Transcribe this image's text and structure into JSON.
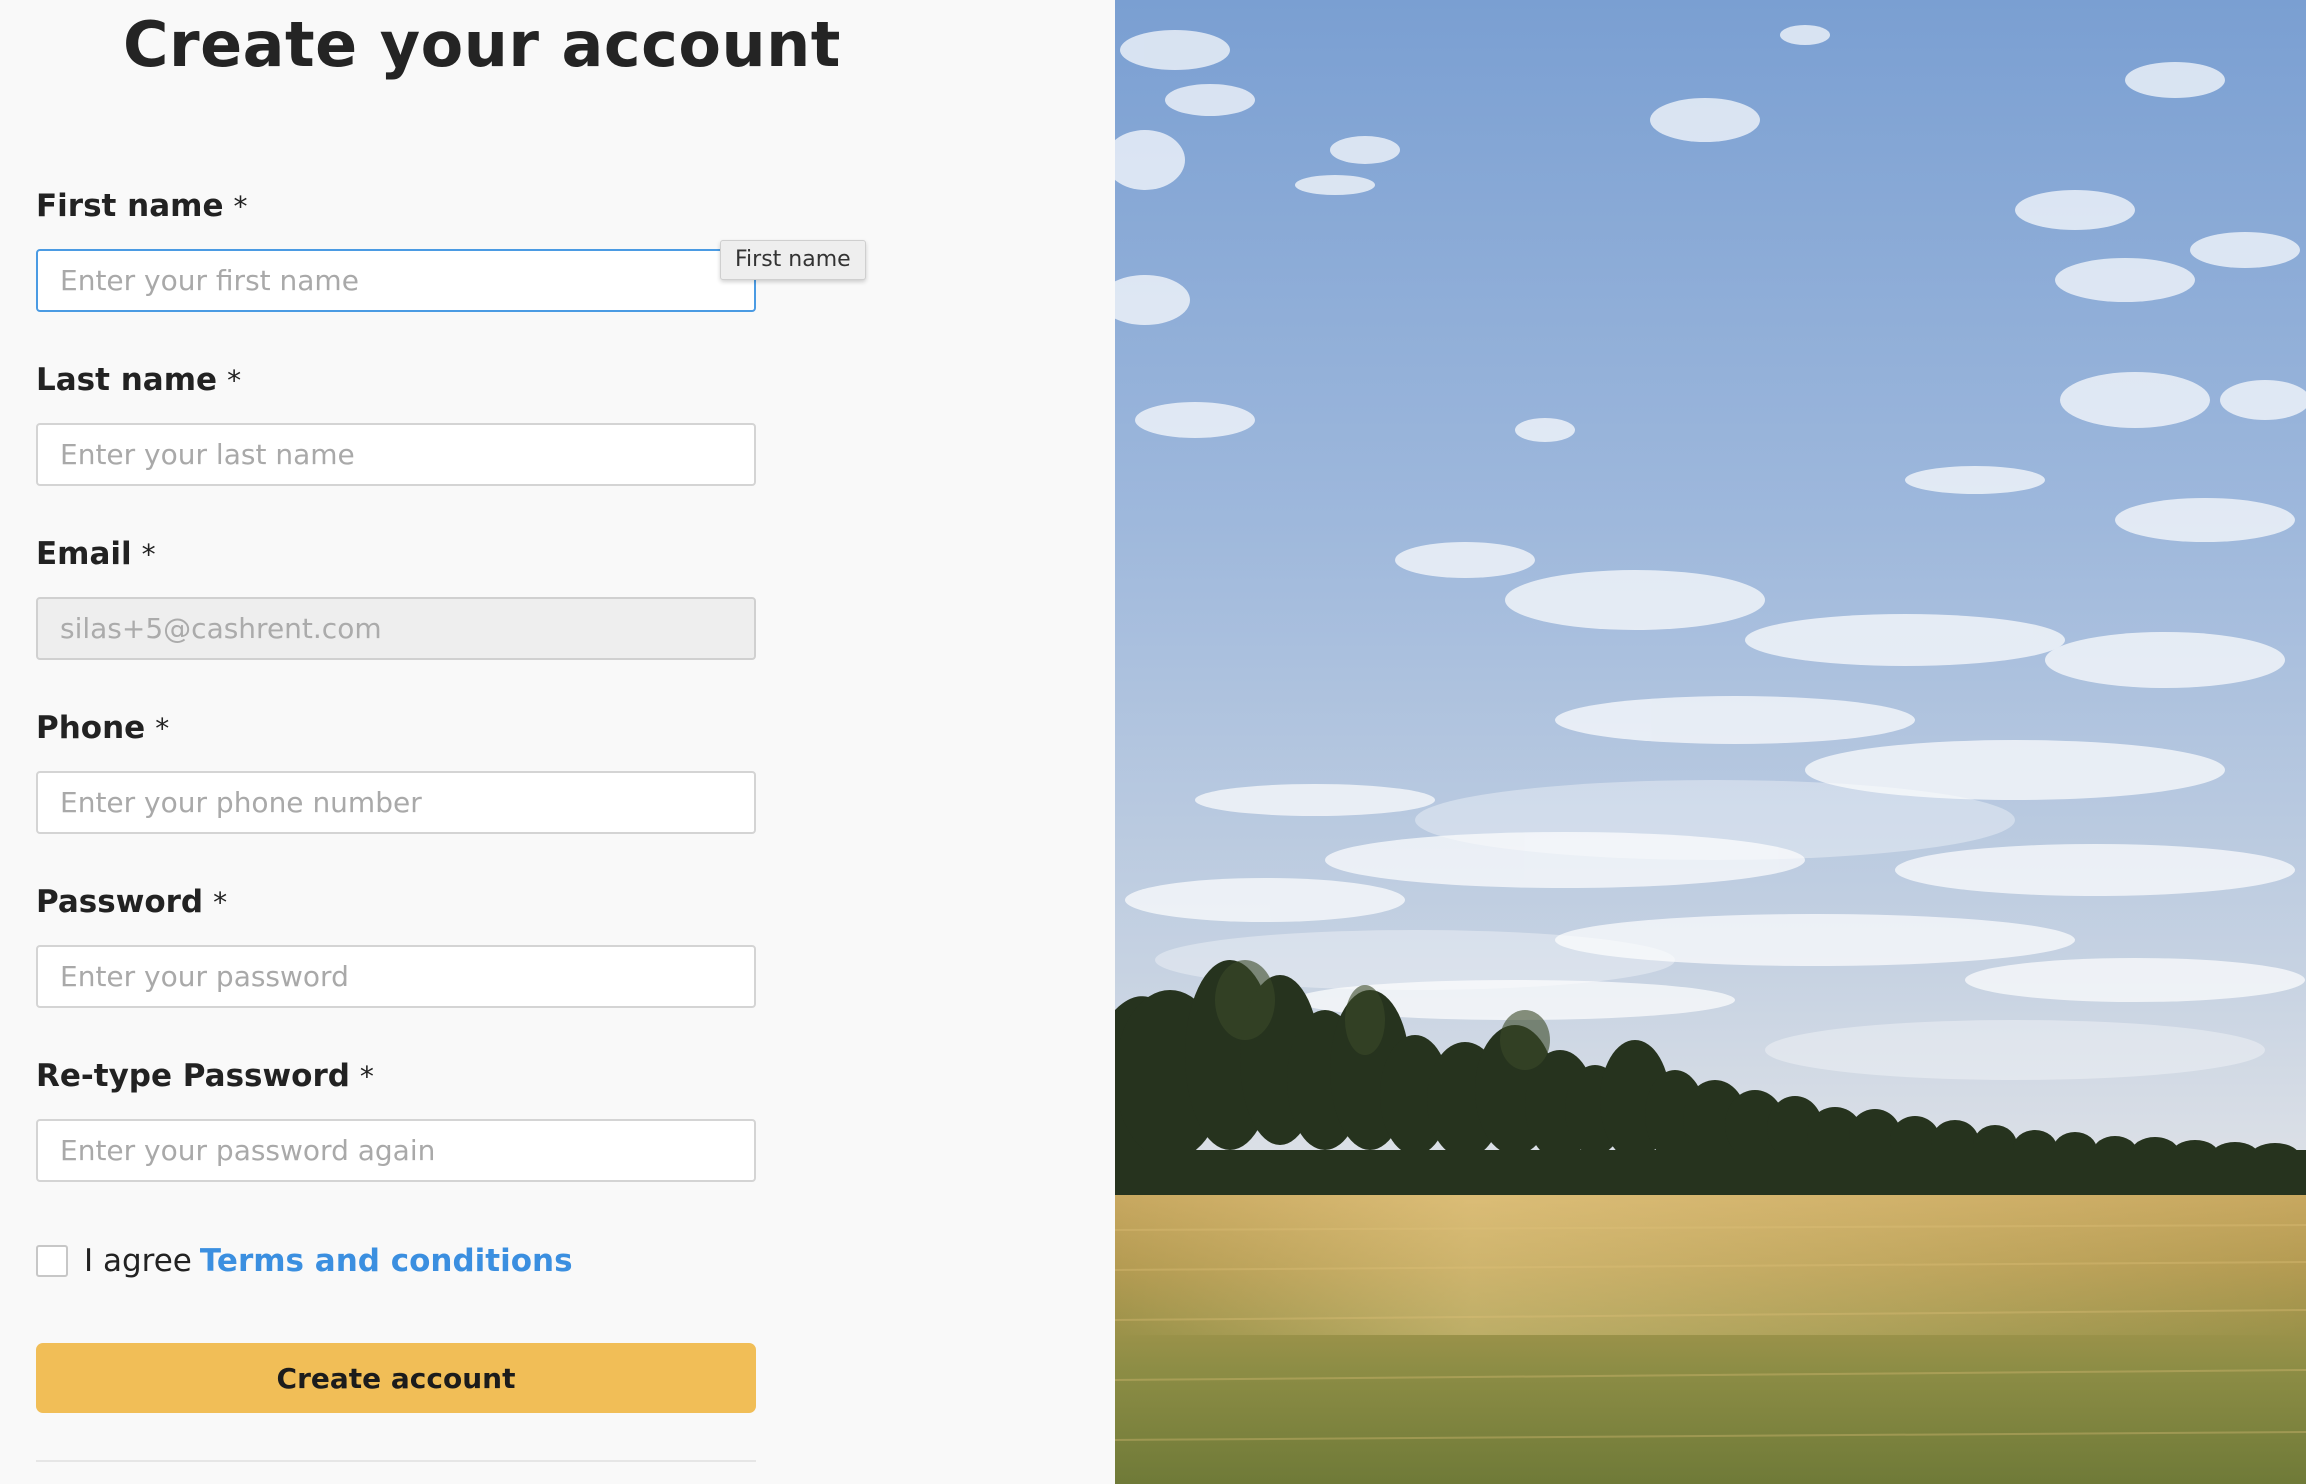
{
  "form": {
    "title": "Create your account",
    "required_mark": "*",
    "fields": {
      "first_name": {
        "label": "First name",
        "placeholder": "Enter your first name",
        "value": ""
      },
      "last_name": {
        "label": "Last name",
        "placeholder": "Enter your last name",
        "value": ""
      },
      "email": {
        "label": "Email",
        "placeholder": "",
        "value": "silas+5@cashrent.com"
      },
      "phone": {
        "label": "Phone",
        "placeholder": "Enter your phone number",
        "value": ""
      },
      "password": {
        "label": "Password",
        "placeholder": "Enter your password",
        "value": ""
      },
      "retype_password": {
        "label": "Re-type Password",
        "placeholder": "Enter your password again",
        "value": ""
      }
    },
    "tooltip": "First name",
    "agree_prefix": "I agree",
    "terms_link": "Terms and conditions",
    "submit_label": "Create account"
  },
  "colors": {
    "background": "#f9f9f9",
    "focus_border": "#4b9be3",
    "link": "#3b8fe0",
    "button": "#f1be57",
    "sky_top": "#7a9fd2",
    "sky_bottom": "#e2e4e8",
    "field": "#9c9a4e"
  }
}
